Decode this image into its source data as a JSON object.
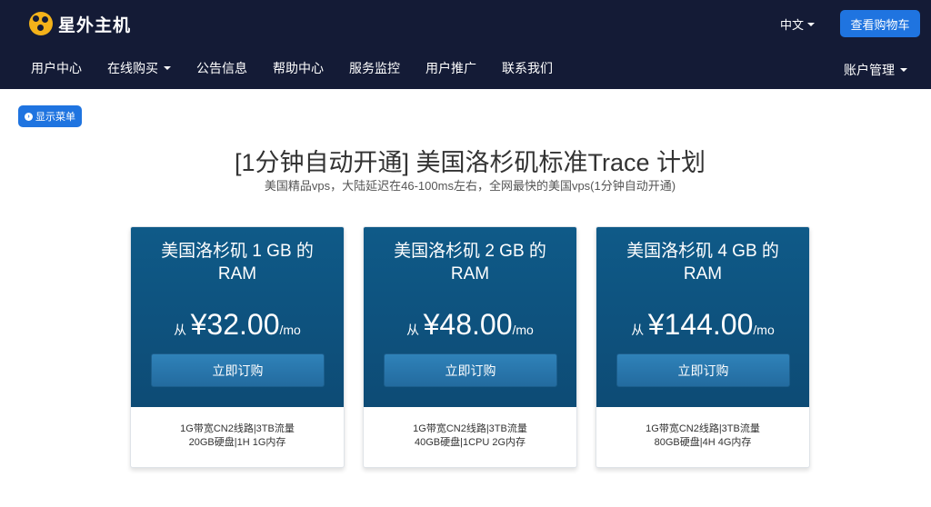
{
  "header": {
    "brand": "星外主机",
    "language": "中文",
    "cart_button": "查看购物车"
  },
  "nav": {
    "items": [
      {
        "label": "用户中心",
        "dropdown": false
      },
      {
        "label": "在线购买",
        "dropdown": true
      },
      {
        "label": "公告信息",
        "dropdown": false
      },
      {
        "label": "帮助中心",
        "dropdown": false
      },
      {
        "label": "服务监控",
        "dropdown": false
      },
      {
        "label": "用户推广",
        "dropdown": false
      },
      {
        "label": "联系我们",
        "dropdown": false
      }
    ],
    "account": "账户管理"
  },
  "show_menu": "显示菜单",
  "page": {
    "title": "[1分钟自动开通] 美国洛杉矶标准Trace 计划",
    "subtitle": "美国精品vps，大陆延迟在46-100ms左右，全网最快的美国vps(1分钟自动开通)"
  },
  "plans": [
    {
      "name_line1": "美国洛杉矶 1 GB 的",
      "name_line2": "RAM",
      "from": "从",
      "price": "¥32.00",
      "period": "/mo",
      "order": "立即订购",
      "desc_line1": "1G带宽CN2线路|3TB流量",
      "desc_line2": "20GB硬盘|1H 1G内存"
    },
    {
      "name_line1": "美国洛杉矶 2 GB 的",
      "name_line2": "RAM",
      "from": "从",
      "price": "¥48.00",
      "period": "/mo",
      "order": "立即订购",
      "desc_line1": "1G带宽CN2线路|3TB流量",
      "desc_line2": "40GB硬盘|1CPU 2G内存"
    },
    {
      "name_line1": "美国洛杉矶 4 GB 的",
      "name_line2": "RAM",
      "from": "从",
      "price": "¥144.00",
      "period": "/mo",
      "order": "立即订购",
      "desc_line1": "1G带宽CN2线路|3TB流量",
      "desc_line2": "80GB硬盘|4H 4G内存"
    }
  ],
  "colors": {
    "header_bg": "#141b36",
    "accent": "#1f74e0",
    "card_head": "#0f5a88",
    "logo": "#f3b21a"
  }
}
